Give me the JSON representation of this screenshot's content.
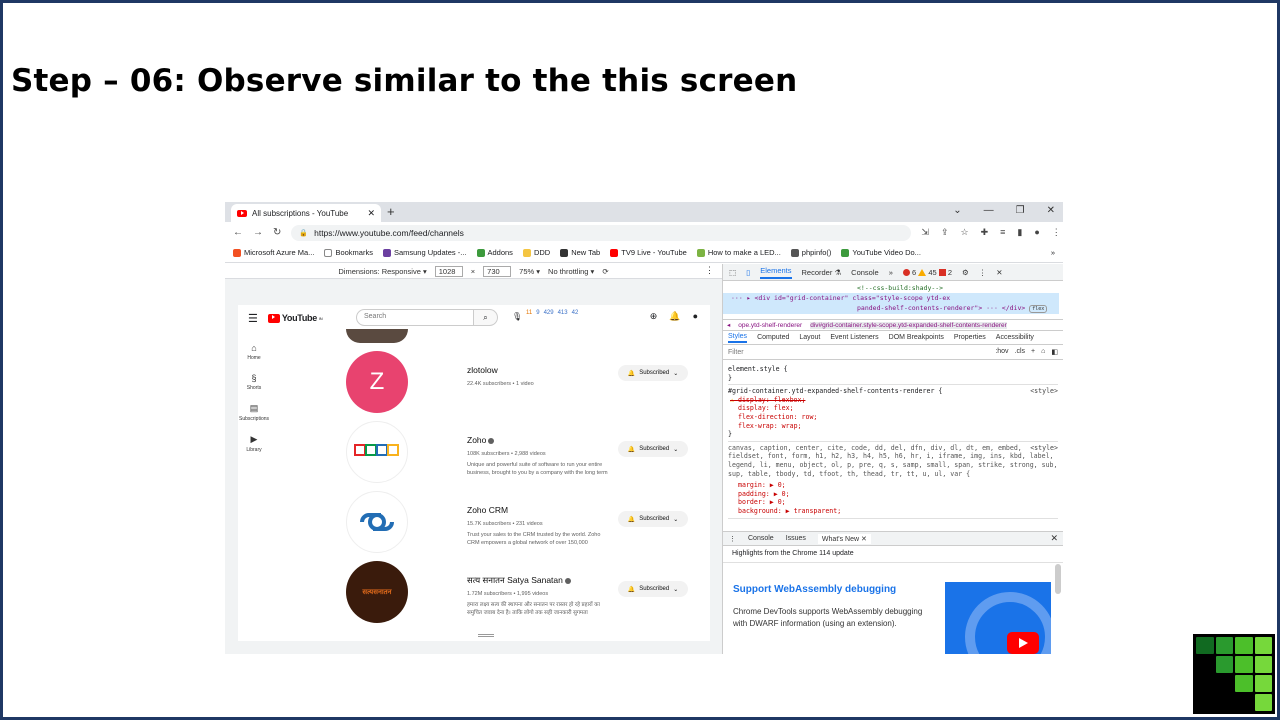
{
  "slide": {
    "title": "Step – 06: Observe similar to the this screen"
  },
  "browser": {
    "tab_title": "All subscriptions - YouTube",
    "url": "https://www.youtube.com/feed/channels",
    "bookmarks": [
      {
        "label": "Microsoft Azure Ma...",
        "color": "#f25022"
      },
      {
        "label": "Bookmarks",
        "color": "#ffffff"
      },
      {
        "label": "Samsung Updates -...",
        "color": "#6b3fa0"
      },
      {
        "label": "Addons",
        "color": "#3c9a3c"
      },
      {
        "label": "DDD",
        "color": "#f4c542"
      },
      {
        "label": "New Tab",
        "color": "#333333"
      },
      {
        "label": "TV9 Live - YouTube",
        "color": "#ff0000"
      },
      {
        "label": "How to make a LED...",
        "color": "#7cb342"
      },
      {
        "label": "phpinfo()",
        "color": "#555555"
      },
      {
        "label": "YouTube Video Do...",
        "color": "#3c9a3c"
      }
    ]
  },
  "device_toolbar": {
    "dimensions": "Dimensions: Responsive",
    "width": "1028",
    "height": "730",
    "zoom": "75%",
    "throttle": "No throttling"
  },
  "youtube": {
    "logo_text": "YouTube",
    "country": "IN",
    "search_placeholder": "Search",
    "sidebar": [
      {
        "icon": "home-icon",
        "label": "Home"
      },
      {
        "icon": "shorts-icon",
        "label": "Shorts"
      },
      {
        "icon": "subscriptions-icon",
        "label": "Subscriptions"
      },
      {
        "icon": "library-icon",
        "label": "Library"
      }
    ],
    "channels": [
      {
        "name": "zlotolow",
        "meta": "22.4K subscribers • 1 video",
        "desc": "",
        "avatar_letter": "Z",
        "avatar_color": "#e8436f",
        "verified": false,
        "button": "Subscribed"
      },
      {
        "name": "Zoho",
        "meta": "108K subscribers • 2,988 videos",
        "desc": "Unique and powerful suite of software to run your entire business, brought to you by a company with the long term",
        "avatar_letter": "",
        "avatar_color": "#ffffff",
        "verified": true,
        "button": "Subscribed"
      },
      {
        "name": "Zoho CRM",
        "meta": "15.7K subscribers • 231 videos",
        "desc": "Trust your sales to the CRM trusted by the world. Zoho CRM empowers a global network of over 150,000",
        "avatar_letter": "",
        "avatar_color": "#ffffff",
        "verified": false,
        "button": "Subscribed"
      },
      {
        "name": "सत्य सनातन Satya Sanatan",
        "meta": "1.72M subscribers • 1,995 videos",
        "desc": "हमारा लक्ष्य सत्य की स्थापना और सनातन पर रास्तर हो रहे प्रहारों का समुचित जवाब देना है। ताकि लोगो तक सही जानकारी सुगमता",
        "avatar_letter": "सत्यसनातन",
        "avatar_color": "#3a1b0c",
        "verified": true,
        "button": "Subscribed"
      }
    ]
  },
  "devtools": {
    "tabs": [
      "Elements",
      "Recorder",
      "Console"
    ],
    "errors": "6",
    "warnings": "45",
    "issues": "2",
    "dom_comment": "<!--css-build:shady-->",
    "dom_line": "<div id=\"grid-container\" class=\"style-scope ytd-ex",
    "dom_line2": "panded-shelf-contents-renderer\"> ··· </div>",
    "dom_badge": "flex",
    "crumbs": [
      "ope.ytd-shelf-renderer",
      "div#grid-container.style-scope.ytd-expanded-shelf-contents-renderer"
    ],
    "subtabs": [
      "Styles",
      "Computed",
      "Layout",
      "Event Listeners",
      "DOM Breakpoints",
      "Properties",
      "Accessibility"
    ],
    "filter_placeholder": "Filter",
    "filter_tools": [
      ":hov",
      ".cls"
    ],
    "element_style": "element.style {",
    "rule1_selector": "#grid-container.ytd-expanded-shelf-contents-renderer {",
    "rule1_source": "<style>",
    "rule1_props": [
      "display: flexbox;",
      "display: flex;",
      "flex-direction: row;",
      "flex-wrap: wrap;"
    ],
    "rule2_selector": "canvas, caption, center, cite, code, dd, del, dfn, div, dl, dt, em, embed, fieldset, font, form, h1, h2, h3, h4, h5, h6, hr, i, iframe, img, ins, kbd, label, legend, li, menu, object, ol, p, pre, q, s, samp, small, span, strike, strong, sub, sup, table, tbody, td, tfoot, th, thead, tr, tt, u, ul, var {",
    "rule2_source": "<style>",
    "rule2_props": [
      "margin: ▶ 0;",
      "padding: ▶ 0;",
      "border: ▶ 0;",
      "background: ▶ transparent;"
    ],
    "drawer_tabs": [
      "Console",
      "Issues",
      "What's New"
    ],
    "highlights": "Highlights from the Chrome 114 update",
    "whatsnew_title": "Support WebAssembly debugging",
    "whatsnew_body": "Chrome DevTools supports WebAssembly debugging with DWARF information (using an extension)."
  }
}
